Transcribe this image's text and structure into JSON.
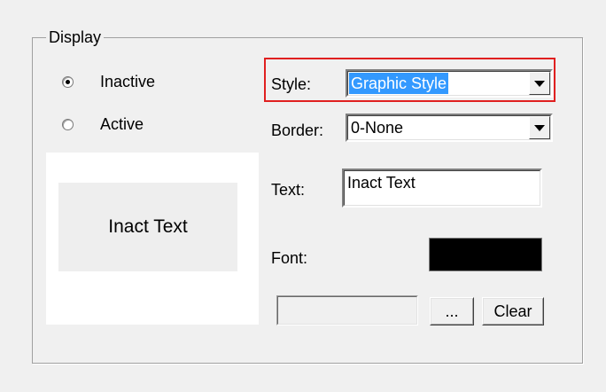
{
  "display_group": {
    "legend": "Display",
    "state_options": [
      {
        "label": "Inactive",
        "selected": true
      },
      {
        "label": "Active",
        "selected": false
      }
    ],
    "preview_text": "Inact Text"
  },
  "properties": {
    "style": {
      "label": "Style:",
      "value": "Graphic Style"
    },
    "border": {
      "label": "Border:",
      "value": "0-None"
    },
    "text": {
      "label": "Text:",
      "value": "Inact Text"
    },
    "font": {
      "label": "Font:",
      "swatch_color": "#000000"
    },
    "browse_label": "...",
    "clear_label": "Clear"
  },
  "colors": {
    "highlight_outline": "#e02020",
    "selection": "#3399ff"
  }
}
